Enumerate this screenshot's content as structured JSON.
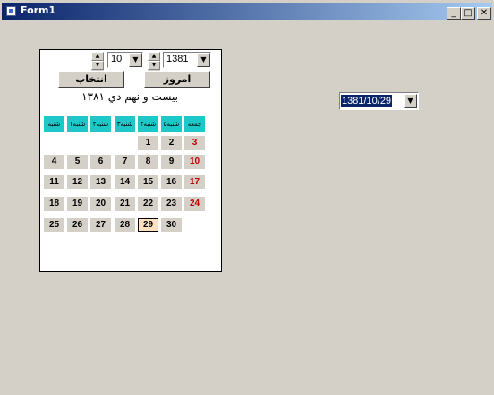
{
  "window": {
    "title": "Form1",
    "min_glyph": "_",
    "max_glyph": "□",
    "close_glyph": "✕"
  },
  "calendar": {
    "month_value": "10",
    "year_value": "1381",
    "select_button": "انتخاب",
    "today_button": "امروز",
    "date_text": "بيست و نهم دي  ١٣٨١",
    "day_headers": [
      "شنبه",
      "۱شنبه",
      "۲شنبه",
      "۳شنبه",
      "۴شنبه",
      "۵شنبه",
      "جمعه"
    ],
    "weeks": [
      [
        "",
        "",
        "",
        "",
        "1",
        "2",
        "3"
      ],
      [
        "4",
        "5",
        "6",
        "7",
        "8",
        "9",
        "10"
      ],
      [
        "11",
        "12",
        "13",
        "14",
        "15",
        "16",
        "17"
      ],
      [
        "18",
        "19",
        "20",
        "21",
        "22",
        "23",
        "24"
      ],
      [
        "25",
        "26",
        "27",
        "28",
        "29",
        "30",
        ""
      ]
    ],
    "today": "29",
    "header_color": "#1fc8c8",
    "friday_color": "#c00000"
  },
  "datepicker": {
    "value": "1381/10/29"
  },
  "icons": {
    "spin_up": "▲",
    "spin_down": "▼",
    "dropdown": "▼"
  }
}
